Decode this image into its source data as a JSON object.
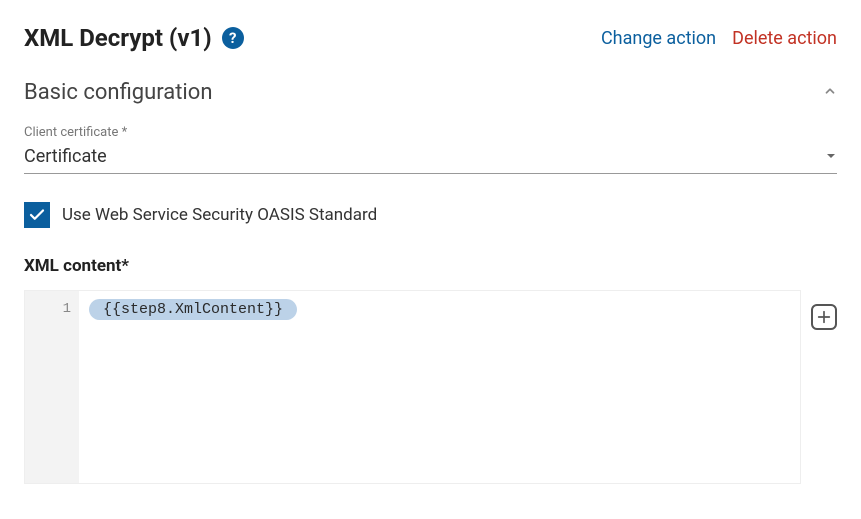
{
  "header": {
    "title": "XML Decrypt (v1)",
    "change_action": "Change action",
    "delete_action": "Delete action"
  },
  "section": {
    "title": "Basic configuration"
  },
  "client_cert": {
    "label": "Client certificate *",
    "value": "Certificate"
  },
  "checkbox": {
    "label": "Use Web Service Security OASIS Standard",
    "checked": true
  },
  "xml_content": {
    "label": "XML content*",
    "line_number": "1",
    "pill_text": "{{step8.XmlContent}}"
  }
}
